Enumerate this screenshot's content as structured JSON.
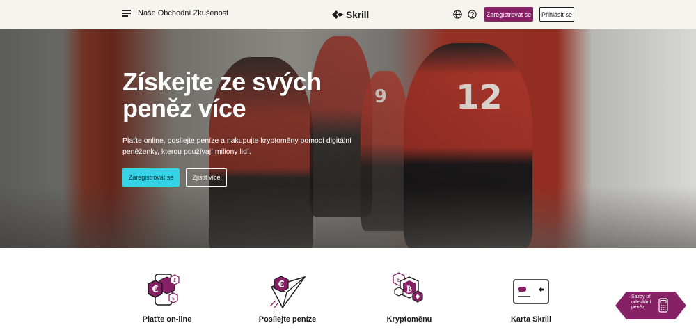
{
  "header": {
    "nav_label": "Naše Obchodní Zkušenost",
    "logo_text": "Skrill",
    "register_label": "Zaregistrovat se",
    "login_label": "Přihlásit se"
  },
  "hero": {
    "title": "Získejte ze svých peněz více",
    "subtitle": "Plaťte online, posílejte peníze a nakupujte kryptoměny pomocí digitální peněženky, kterou používají miliony lidí.",
    "register_label": "Zaregistrovat se",
    "more_label": "Zjistit více",
    "jersey_numbers": [
      "12",
      "9"
    ]
  },
  "features": [
    {
      "label": "Plaťte on-line",
      "icon": "pay-online-icon"
    },
    {
      "label": "Posílejte peníze",
      "icon": "send-money-icon"
    },
    {
      "label": "Kryptoměnu",
      "icon": "crypto-icon"
    },
    {
      "label": "Karta Skrill",
      "icon": "card-icon"
    }
  ],
  "fees_badge": {
    "label": "Sazby při odesílání peněz",
    "icon": "calculator-icon"
  },
  "colors": {
    "brand_purple": "#862165",
    "accent_cyan": "#34d3e6",
    "header_bg": "#f5f4ef"
  }
}
